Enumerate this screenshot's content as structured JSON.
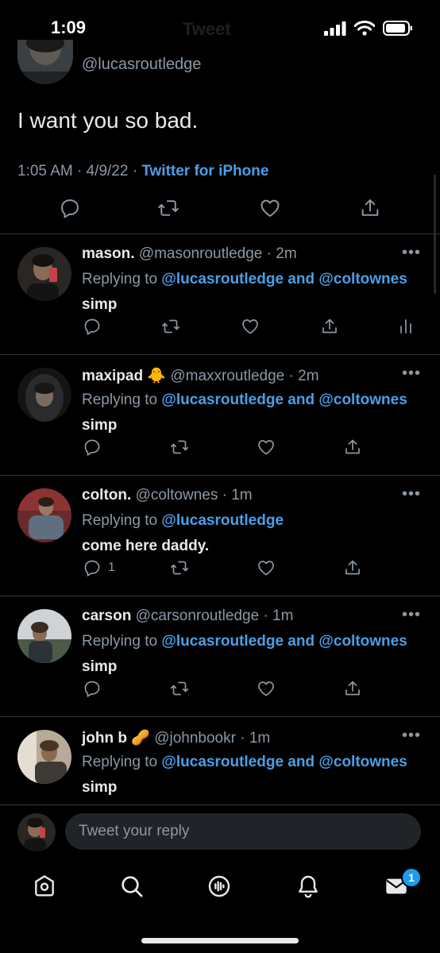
{
  "status_bar": {
    "time": "1:09",
    "ghost_title": "Tweet"
  },
  "main_tweet": {
    "handle": "@lucasroutledge",
    "text": "I want you so bad.",
    "time": "1:05 AM",
    "date": "4/9/22",
    "source": "Twitter for iPhone"
  },
  "replies": [
    {
      "name": "mason.",
      "emoji": "",
      "handle": "@masonroutledge",
      "age": "2m",
      "replying_label": "Replying to",
      "mentions": "@lucasroutledge and @coltownes",
      "text": "simp",
      "reply_count": ""
    },
    {
      "name": "maxipad",
      "emoji": "🐥",
      "handle": "@maxxroutledge",
      "age": "2m",
      "replying_label": "Replying to",
      "mentions": "@lucasroutledge and @coltownes",
      "text": "simp",
      "reply_count": ""
    },
    {
      "name": "colton.",
      "emoji": "",
      "handle": "@coltownes",
      "age": "1m",
      "replying_label": "Replying to",
      "mentions": "@lucasroutledge",
      "text": "come here daddy.",
      "reply_count": "1"
    },
    {
      "name": "carson",
      "emoji": "",
      "handle": "@carsonroutledge",
      "age": "1m",
      "replying_label": "Replying to",
      "mentions": "@lucasroutledge and @coltownes",
      "text": "simp",
      "reply_count": ""
    },
    {
      "name": "john b",
      "emoji": "🥜",
      "handle": "@johnbookr",
      "age": "1m",
      "replying_label": "Replying to",
      "mentions": "@lucasroutledge and @coltownes",
      "text": "simp",
      "reply_count": ""
    }
  ],
  "reply_box": {
    "placeholder": "Tweet your reply"
  },
  "nav": {
    "messages_badge": "1"
  },
  "colors": {
    "accent": "#1d9bf0",
    "link": "#4a9fe8",
    "muted": "#8b98a5",
    "background": "#000000"
  }
}
